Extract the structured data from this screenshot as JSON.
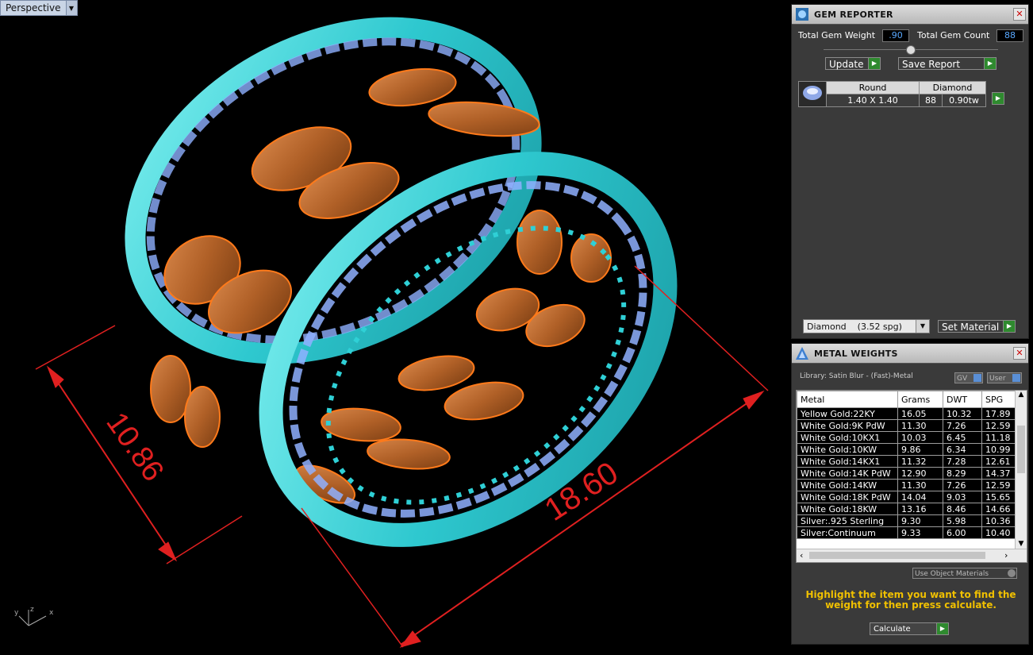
{
  "viewport": {
    "label": "Perspective",
    "dimensions": [
      "10.86",
      "18.60"
    ],
    "axes": [
      "y",
      "z",
      "x"
    ]
  },
  "gem_reporter": {
    "title": "GEM REPORTER",
    "total_gem_weight_label": "Total Gem Weight",
    "total_gem_weight": ".90",
    "total_gem_count_label": "Total Gem Count",
    "total_gem_count": "88",
    "update_label": "Update",
    "save_report_label": "Save Report",
    "table": {
      "headers": [
        "Round",
        "Diamond"
      ],
      "size": "1.40 X 1.40",
      "count": "88",
      "weight": "0.90tw"
    },
    "material_select": "Diamond    (3.52 spg)",
    "set_material_label": "Set Material"
  },
  "metal_weights": {
    "title": "METAL WEIGHTS",
    "library": "Library: Satin Blur - (Fast)-Metal",
    "gv_label": "GV",
    "user_label": "User",
    "columns": [
      "Metal",
      "Grams",
      "DWT",
      "SPG"
    ],
    "rows": [
      [
        "Yellow Gold:22KY",
        "16.05",
        "10.32",
        "17.89"
      ],
      [
        "White Gold:9K PdW",
        "11.30",
        "7.26",
        "12.59"
      ],
      [
        "White Gold:10KX1",
        "10.03",
        "6.45",
        "11.18"
      ],
      [
        "White Gold:10KW",
        "9.86",
        "6.34",
        "10.99"
      ],
      [
        "White Gold:14KX1",
        "11.32",
        "7.28",
        "12.61"
      ],
      [
        "White Gold:14K PdW",
        "12.90",
        "8.29",
        "14.37"
      ],
      [
        "White Gold:14KW",
        "11.30",
        "7.26",
        "12.59"
      ],
      [
        "White Gold:18K PdW",
        "14.04",
        "9.03",
        "15.65"
      ],
      [
        "White Gold:18KW",
        "13.16",
        "8.46",
        "14.66"
      ],
      [
        "Silver:.925 Sterling",
        "9.30",
        "5.98",
        "10.36"
      ],
      [
        "Silver:Continuum",
        "9.33",
        "6.00",
        "10.40"
      ]
    ],
    "use_object_materials": "Use Object Materials",
    "hint": "Highlight the item you want to find the weight for then press calculate.",
    "calculate_label": "Calculate"
  }
}
